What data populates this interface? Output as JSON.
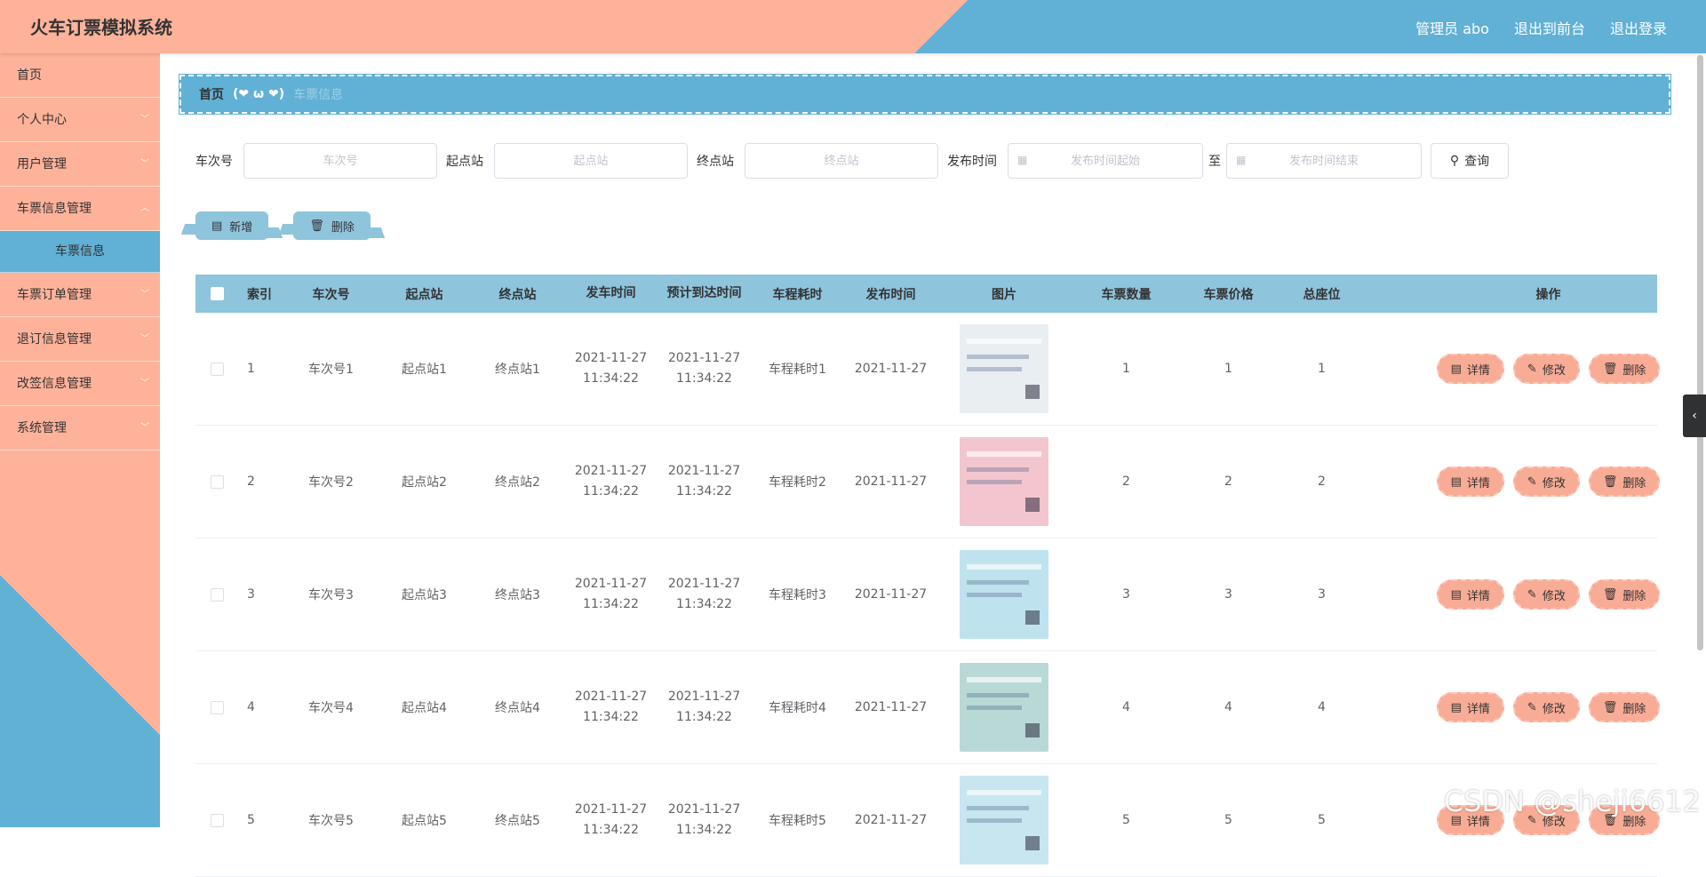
{
  "header": {
    "title": "火车订票模拟系统",
    "admin": "管理员 abo",
    "to_front": "退出到前台",
    "logout": "退出登录"
  },
  "sidebar": {
    "items": [
      {
        "label": "首页",
        "has_children": false
      },
      {
        "label": "个人中心",
        "has_children": true
      },
      {
        "label": "用户管理",
        "has_children": true
      },
      {
        "label": "车票信息管理",
        "has_children": true
      },
      {
        "label": "车票订单管理",
        "has_children": true
      },
      {
        "label": "退订信息管理",
        "has_children": true
      },
      {
        "label": "改签信息管理",
        "has_children": true
      },
      {
        "label": "系统管理",
        "has_children": true
      }
    ],
    "sub_item": "车票信息"
  },
  "breadcrumb": {
    "home": "首页",
    "separator": "(❤ ω ❤)",
    "current": "车票信息"
  },
  "search": {
    "train_no_label": "车次号",
    "train_no_placeholder": "车次号",
    "from_label": "起点站",
    "from_placeholder": "起点站",
    "to_label": "终点站",
    "to_placeholder": "终点站",
    "time_label": "发布时间",
    "time_start_placeholder": "发布时间起始",
    "time_to": "至",
    "time_end_placeholder": "发布时间结束",
    "query": "查询"
  },
  "actions": {
    "add": "新增",
    "delete": "删除"
  },
  "table": {
    "headers": {
      "index": "索引",
      "train_no": "车次号",
      "from": "起点站",
      "to": "终点站",
      "depart": "发车时间",
      "arrive": "预计到达时间",
      "duration": "车程耗时",
      "publish": "发布时间",
      "image": "图片",
      "qty": "车票数量",
      "price": "车票价格",
      "seats": "总座位",
      "ops": "操作"
    },
    "op_labels": {
      "detail": "详情",
      "edit": "修改",
      "delete": "删除"
    },
    "rows": [
      {
        "index": "1",
        "train_no": "车次号1",
        "from": "起点站1",
        "to": "终点站1",
        "depart_date": "2021-11-27",
        "depart_time": "11:34:22",
        "arrive_date": "2021-11-27",
        "arrive_time": "11:34:22",
        "duration": "车程耗时1",
        "publish": "2021-11-27",
        "qty": "1",
        "price": "1",
        "seats": "1",
        "img_color": "#e9eef2"
      },
      {
        "index": "2",
        "train_no": "车次号2",
        "from": "起点站2",
        "to": "终点站2",
        "depart_date": "2021-11-27",
        "depart_time": "11:34:22",
        "arrive_date": "2021-11-27",
        "arrive_time": "11:34:22",
        "duration": "车程耗时2",
        "publish": "2021-11-27",
        "qty": "2",
        "price": "2",
        "seats": "2",
        "img_color": "#f3c6cf"
      },
      {
        "index": "3",
        "train_no": "车次号3",
        "from": "起点站3",
        "to": "终点站3",
        "depart_date": "2021-11-27",
        "depart_time": "11:34:22",
        "arrive_date": "2021-11-27",
        "arrive_time": "11:34:22",
        "duration": "车程耗时3",
        "publish": "2021-11-27",
        "qty": "3",
        "price": "3",
        "seats": "3",
        "img_color": "#bfe3ee"
      },
      {
        "index": "4",
        "train_no": "车次号4",
        "from": "起点站4",
        "to": "终点站4",
        "depart_date": "2021-11-27",
        "depart_time": "11:34:22",
        "arrive_date": "2021-11-27",
        "arrive_time": "11:34:22",
        "duration": "车程耗时4",
        "publish": "2021-11-27",
        "qty": "4",
        "price": "4",
        "seats": "4",
        "img_color": "#b9d9d6"
      },
      {
        "index": "5",
        "train_no": "车次号5",
        "from": "起点站5",
        "to": "终点站5",
        "depart_date": "2021-11-27",
        "depart_time": "11:34:22",
        "arrive_date": "2021-11-27",
        "arrive_time": "11:34:22",
        "duration": "车程耗时5",
        "publish": "2021-11-27",
        "qty": "5",
        "price": "5",
        "seats": "5",
        "img_color": "#c7e6f0"
      }
    ]
  },
  "watermark": "CSDN @sheji6612",
  "colors": {
    "salmon": "#ffb29a",
    "blue": "#61b0d6",
    "light_blue": "#8ec4dc",
    "button_salmon": "#f8ab95"
  }
}
